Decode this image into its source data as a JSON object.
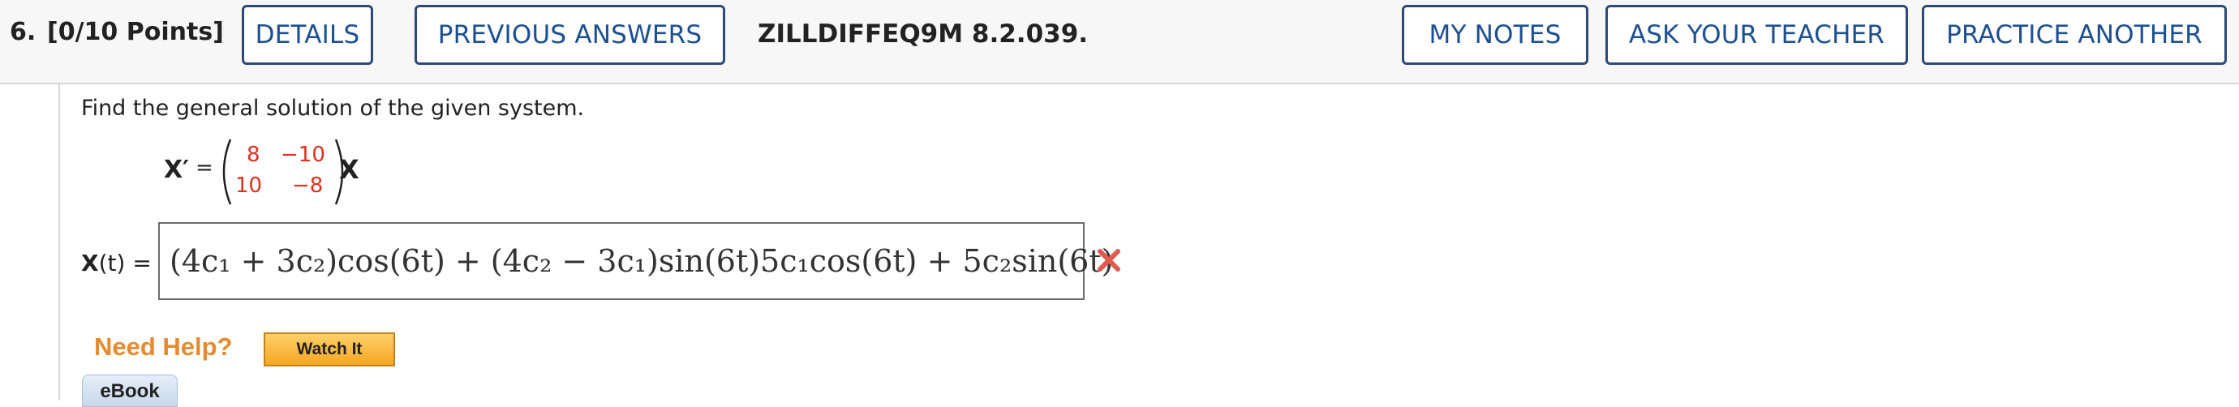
{
  "question": {
    "number": "6.",
    "points": "[0/10 Points]",
    "id": "ZILLDIFFEQ9M 8.2.039."
  },
  "toolbar": {
    "details_label": "DETAILS",
    "previous_answers_label": "PREVIOUS ANSWERS",
    "my_notes_label": "MY NOTES",
    "ask_teacher_label": "ASK YOUR TEACHER",
    "practice_another_label": "PRACTICE ANOTHER"
  },
  "problem": {
    "prompt": "Find the general solution of the given system.",
    "lhs_symbol": "X′",
    "equals": "=",
    "matrix": [
      [
        "8",
        "−10"
      ],
      [
        "10",
        "−8"
      ]
    ],
    "rhs_symbol": "X"
  },
  "answer": {
    "label_bold": "X",
    "label_rest": "(t) =",
    "value": "(4c₁ + 3c₂)cos(6t) + (4c₂ − 3c₁)sin(6t)5c₁cos(6t) + 5c₂sin(6t)",
    "status": "incorrect"
  },
  "help": {
    "label": "Need Help?",
    "watch_label": "Watch It",
    "ebook_label": "eBook"
  },
  "colors": {
    "button_border": "#2b4a7a",
    "button_text": "#1d4f91",
    "matrix_entry": "#e03020",
    "incorrect_mark": "#e05a50",
    "help_text": "#e58a2e"
  }
}
